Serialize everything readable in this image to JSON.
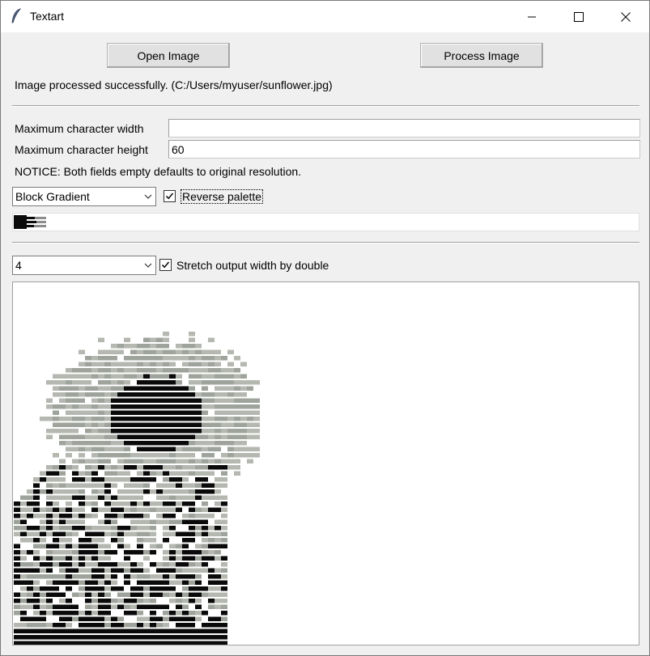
{
  "window": {
    "title": "Textart",
    "icon": "feather-icon"
  },
  "window_controls": {
    "minimize": "minimize-icon",
    "maximize": "maximize-icon",
    "close": "close-icon"
  },
  "toolbar": {
    "open_label": "Open Image",
    "process_label": "Process Image"
  },
  "status_text": "Image processed successfully. (C:/Users/myuser/sunflower.jpg)",
  "dimensions": {
    "width_label": "Maximum character width",
    "width_value": "",
    "height_label": "Maximum character height",
    "height_value": "60",
    "notice": "NOTICE: Both fields empty defaults to original resolution."
  },
  "palette": {
    "selected": "Block Gradient",
    "reverse_label": "Reverse palette",
    "reverse_checked": true
  },
  "output_options": {
    "font_size": "4",
    "stretch_label": "Stretch output width by double",
    "stretch_checked": true
  },
  "colors": {
    "light": "#b4b8b0",
    "mid": "#9ea39b",
    "dark": "#0a0a0a"
  }
}
